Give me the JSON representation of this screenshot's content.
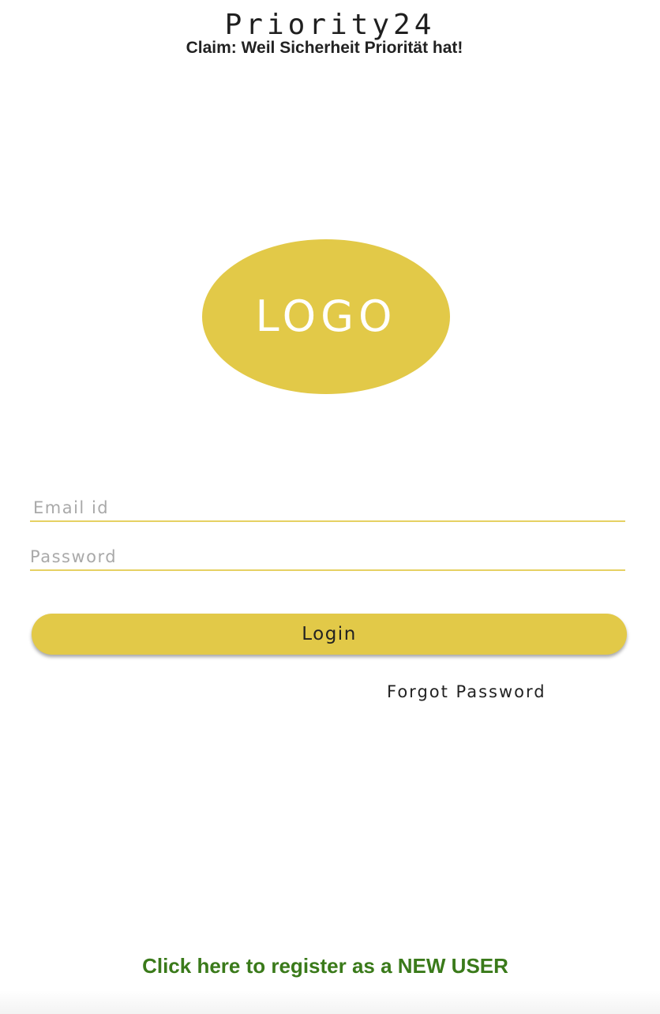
{
  "header": {
    "app_title": "Priority24",
    "claim": "Claim: Weil Sicherheit Priorität hat!"
  },
  "logo": {
    "text": "LOGO"
  },
  "form": {
    "email_placeholder": "Email id",
    "email_value": "",
    "password_placeholder": "Password",
    "password_value": "",
    "login_label": "Login",
    "forgot_password_label": "Forgot Password"
  },
  "footer": {
    "register_label": "Click here to register as a NEW USER"
  },
  "colors": {
    "accent": "#e2c948",
    "underline": "#e6d163",
    "register_link": "#3a7a1a"
  }
}
